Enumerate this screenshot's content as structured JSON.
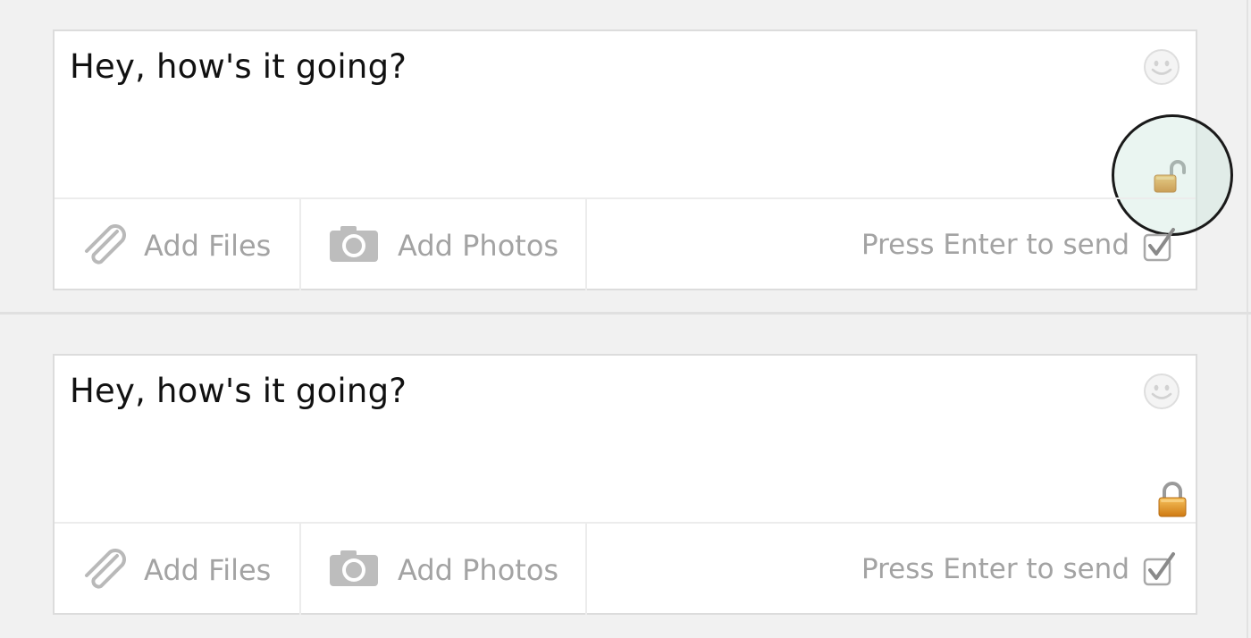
{
  "composers": [
    {
      "message": "Hey, how's it going?",
      "lock_state": "unlocked",
      "lock_icon": "unlocked-padlock-icon",
      "toolbar": {
        "add_files_label": "Add Files",
        "add_photos_label": "Add Photos",
        "enter_to_send_label": "Press Enter to send",
        "enter_to_send_checked": true
      },
      "highlighted_control": "lock-toggle"
    },
    {
      "message": "Hey, how's it going?",
      "lock_state": "locked",
      "lock_icon": "locked-padlock-icon",
      "toolbar": {
        "add_files_label": "Add Files",
        "add_photos_label": "Add Photos",
        "enter_to_send_label": "Press Enter to send",
        "enter_to_send_checked": true
      }
    }
  ],
  "icons": {
    "emoji": "smiley-face-icon",
    "attach": "paperclip-icon",
    "photo": "camera-icon",
    "checkbox": "checkbox-checked-icon"
  },
  "colors": {
    "lock_gold": "#e0952a",
    "label_gray": "#a3a3a3",
    "focus_ring": "#1a1a1a"
  }
}
